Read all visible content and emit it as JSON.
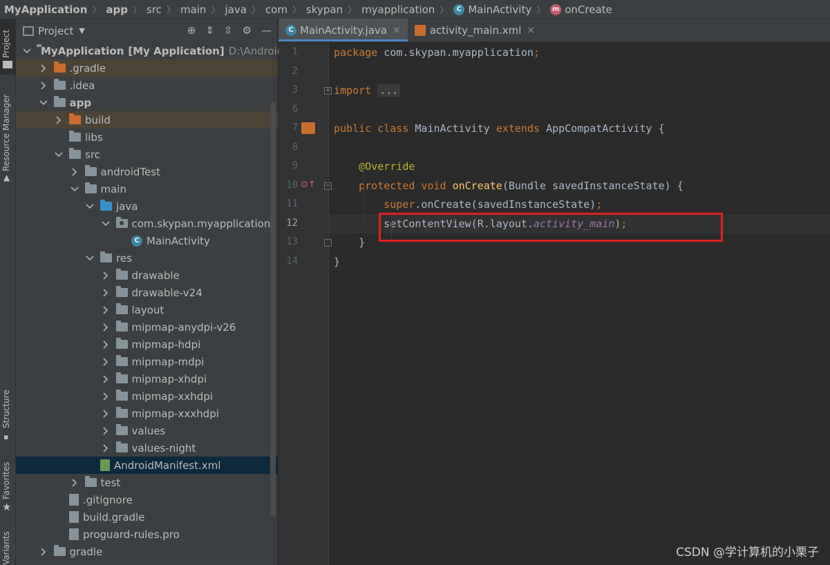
{
  "breadcrumb": [
    {
      "label": "MyApplication",
      "bold": true
    },
    {
      "label": "app",
      "bold": true
    },
    {
      "label": "src"
    },
    {
      "label": "main"
    },
    {
      "label": "java"
    },
    {
      "label": "com"
    },
    {
      "label": "skypan"
    },
    {
      "label": "myapplication"
    },
    {
      "label": "MainActivity",
      "icon": "class-icon"
    },
    {
      "label": "onCreate",
      "icon": "method-icon"
    }
  ],
  "tool_stripe": {
    "project": "Project",
    "resource_manager": "Resource Manager",
    "structure": "Structure",
    "favorites": "Favorites",
    "build_variants": "Variants"
  },
  "project_panel": {
    "title": "Project",
    "tree": [
      {
        "label": "MyApplication",
        "suffix": "[My Application]",
        "path": "D:\\Android",
        "depth": 0,
        "expanded": true,
        "icon": "module"
      },
      {
        "label": ".gradle",
        "depth": 1,
        "expanded": false,
        "icon": "folder-orange",
        "highlight": "orange"
      },
      {
        "label": ".idea",
        "depth": 1,
        "expanded": false,
        "icon": "folder-grey"
      },
      {
        "label": "app",
        "depth": 1,
        "expanded": true,
        "icon": "module",
        "bold": true
      },
      {
        "label": "build",
        "depth": 2,
        "expanded": false,
        "icon": "folder-orange",
        "highlight": "orange"
      },
      {
        "label": "libs",
        "depth": 2,
        "leaf": true,
        "icon": "folder-grey"
      },
      {
        "label": "src",
        "depth": 2,
        "expanded": true,
        "icon": "folder-grey"
      },
      {
        "label": "androidTest",
        "depth": 3,
        "expanded": false,
        "icon": "folder-grey"
      },
      {
        "label": "main",
        "depth": 3,
        "expanded": true,
        "icon": "folder-grey"
      },
      {
        "label": "java",
        "depth": 4,
        "expanded": true,
        "icon": "folder-blue"
      },
      {
        "label": "com.skypan.myapplication",
        "depth": 5,
        "expanded": true,
        "icon": "package"
      },
      {
        "label": "MainActivity",
        "depth": 6,
        "leaf": true,
        "icon": "class"
      },
      {
        "label": "res",
        "depth": 4,
        "expanded": true,
        "icon": "res"
      },
      {
        "label": "drawable",
        "depth": 5,
        "expanded": false,
        "icon": "folder-grey"
      },
      {
        "label": "drawable-v24",
        "depth": 5,
        "expanded": false,
        "icon": "folder-grey"
      },
      {
        "label": "layout",
        "depth": 5,
        "expanded": false,
        "icon": "folder-grey"
      },
      {
        "label": "mipmap-anydpi-v26",
        "depth": 5,
        "expanded": false,
        "icon": "folder-grey"
      },
      {
        "label": "mipmap-hdpi",
        "depth": 5,
        "expanded": false,
        "icon": "folder-grey"
      },
      {
        "label": "mipmap-mdpi",
        "depth": 5,
        "expanded": false,
        "icon": "folder-grey"
      },
      {
        "label": "mipmap-xhdpi",
        "depth": 5,
        "expanded": false,
        "icon": "folder-grey"
      },
      {
        "label": "mipmap-xxhdpi",
        "depth": 5,
        "expanded": false,
        "icon": "folder-grey"
      },
      {
        "label": "mipmap-xxxhdpi",
        "depth": 5,
        "expanded": false,
        "icon": "folder-grey"
      },
      {
        "label": "values",
        "depth": 5,
        "expanded": false,
        "icon": "folder-grey"
      },
      {
        "label": "values-night",
        "depth": 5,
        "expanded": false,
        "icon": "folder-grey"
      },
      {
        "label": "AndroidManifest.xml",
        "depth": 4,
        "leaf": true,
        "icon": "manifest",
        "selected": true
      },
      {
        "label": "test",
        "depth": 3,
        "expanded": false,
        "icon": "folder-grey"
      },
      {
        "label": ".gitignore",
        "depth": 2,
        "leaf": true,
        "icon": "file"
      },
      {
        "label": "build.gradle",
        "depth": 2,
        "leaf": true,
        "icon": "gradle"
      },
      {
        "label": "proguard-rules.pro",
        "depth": 2,
        "leaf": true,
        "icon": "file"
      },
      {
        "label": "gradle",
        "depth": 1,
        "expanded": false,
        "icon": "folder-grey"
      }
    ]
  },
  "editor": {
    "tabs": [
      {
        "label": "MainActivity.java",
        "active": true,
        "icon": "class-icon"
      },
      {
        "label": "activity_main.xml",
        "active": false,
        "icon": "xml-icon"
      }
    ],
    "lines": [
      {
        "n": "1",
        "tokens": [
          {
            "t": "package ",
            "c": "kw"
          },
          {
            "t": "com.skypan.myapplication",
            "c": "pl"
          },
          {
            "t": ";",
            "c": "kw"
          }
        ]
      },
      {
        "n": "2",
        "tokens": []
      },
      {
        "n": "3",
        "tokens": [
          {
            "t": "import ",
            "c": "kw"
          },
          {
            "t": "...",
            "c": "fold-box"
          }
        ]
      },
      {
        "n": "6",
        "tokens": []
      },
      {
        "n": "7",
        "tokens": [
          {
            "t": "public class ",
            "c": "kw"
          },
          {
            "t": "MainActivity ",
            "c": "pl"
          },
          {
            "t": "extends ",
            "c": "kw"
          },
          {
            "t": "AppCompatActivity {",
            "c": "pl"
          }
        ]
      },
      {
        "n": "8",
        "tokens": []
      },
      {
        "n": "9",
        "tokens": [
          {
            "t": "    @Override",
            "c": "an"
          }
        ]
      },
      {
        "n": "10",
        "tokens": [
          {
            "t": "    protected void ",
            "c": "kw"
          },
          {
            "t": "onCreate",
            "c": "fn"
          },
          {
            "t": "(Bundle savedInstanceState) {",
            "c": "pl"
          }
        ]
      },
      {
        "n": "11",
        "tokens": [
          {
            "t": "        super",
            "c": "kw"
          },
          {
            "t": ".onCreate(savedInstanceState)",
            "c": "pl"
          },
          {
            "t": ";",
            "c": "kw"
          }
        ]
      },
      {
        "n": "12",
        "tokens": [
          {
            "t": "        setContentView(R.layout.",
            "c": "pl"
          },
          {
            "t": "activity_main",
            "c": "it"
          },
          {
            "t": ")",
            "c": "pl"
          },
          {
            "t": ";",
            "c": "kw"
          }
        ],
        "current": true
      },
      {
        "n": "13",
        "tokens": [
          {
            "t": "    }",
            "c": "pl"
          }
        ]
      },
      {
        "n": "14",
        "tokens": [
          {
            "t": "}",
            "c": "pl"
          }
        ]
      }
    ]
  },
  "watermark": "CSDN @学计算机的小栗子",
  "colors": {
    "keyword": "#cc7832",
    "plain": "#a9b7c6",
    "annotation": "#bbb529",
    "method": "#ffc66d",
    "field": "#9876aa",
    "highlight_box": "#e02020"
  }
}
